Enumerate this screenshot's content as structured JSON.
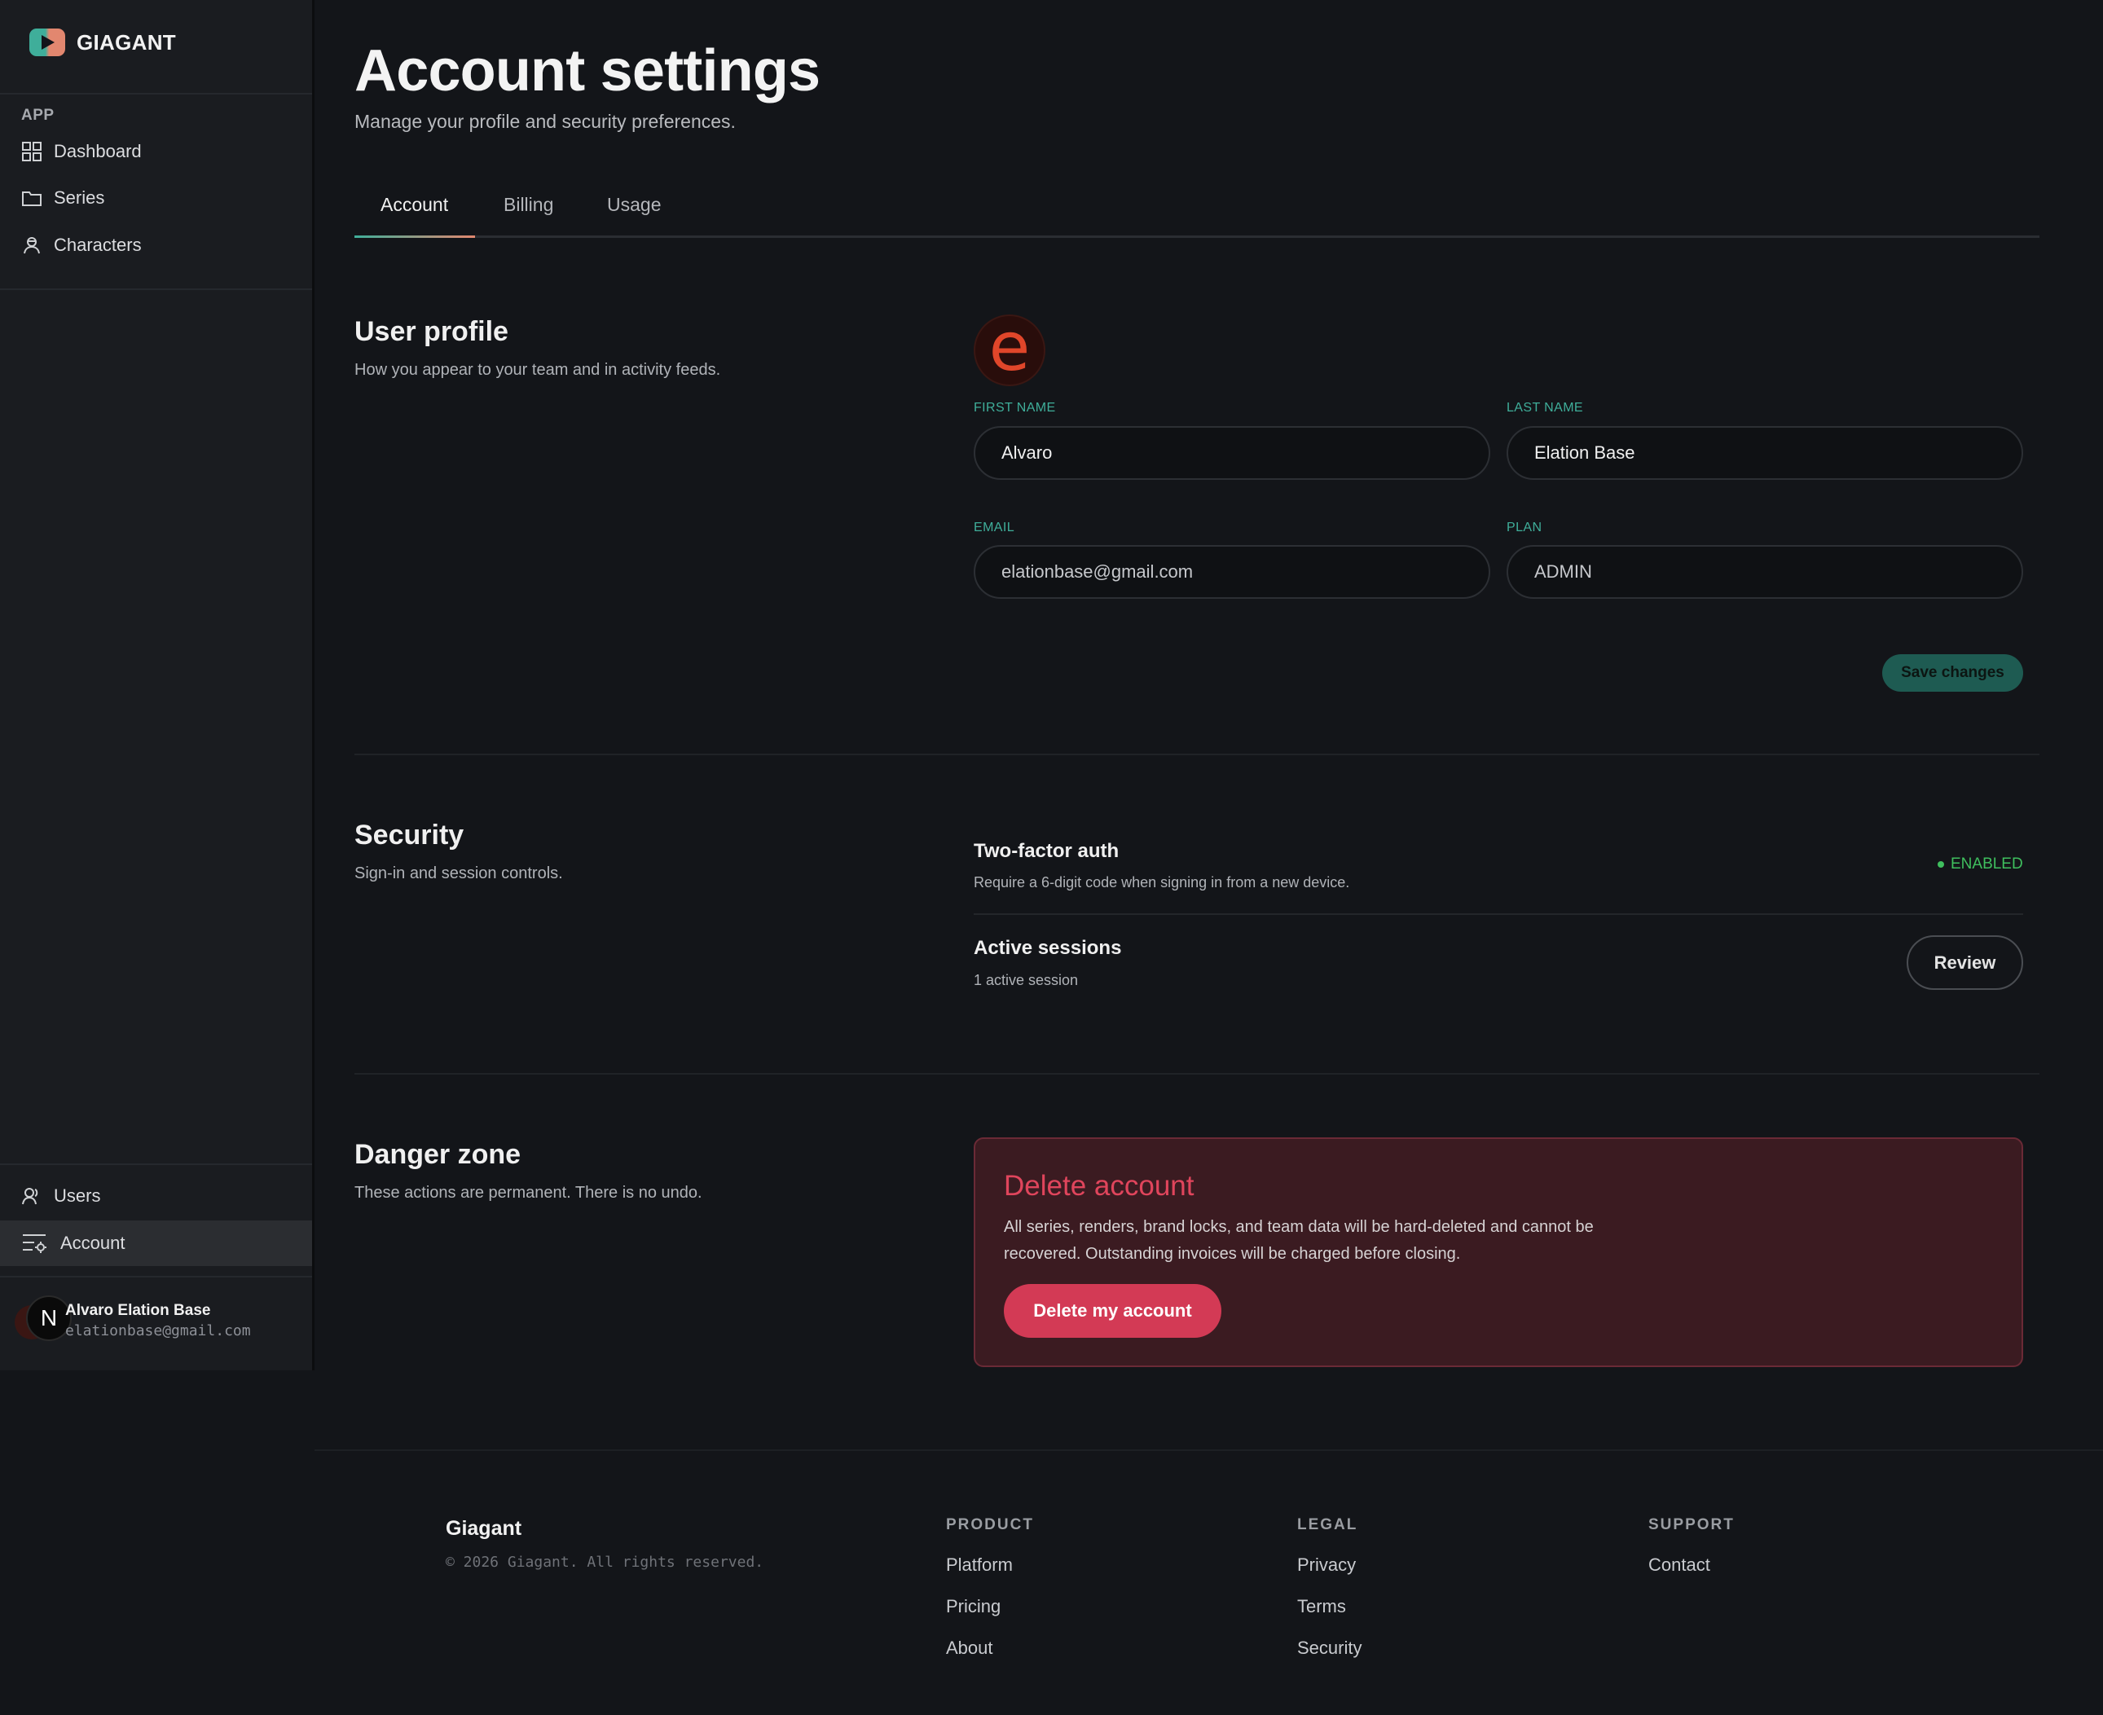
{
  "app": {
    "brand": "GIAGANT"
  },
  "sidebar": {
    "group_label": "APP",
    "items": [
      {
        "label": "Dashboard",
        "icon": "grid-icon"
      },
      {
        "label": "Series",
        "icon": "folder-icon"
      },
      {
        "label": "Characters",
        "icon": "characters-icon"
      }
    ],
    "bottom_items": [
      {
        "label": "Users",
        "icon": "users-icon"
      },
      {
        "label": "Account",
        "icon": "settings-list-icon",
        "active": true
      }
    ],
    "user": {
      "initial": "N",
      "name": "Alvaro Elation Base",
      "email": "elationbase@gmail.com"
    }
  },
  "page": {
    "title": "Account settings",
    "subtitle": "Manage your profile and security preferences.",
    "tabs": [
      {
        "label": "Account",
        "active": true
      },
      {
        "label": "Billing"
      },
      {
        "label": "Usage"
      }
    ]
  },
  "profile": {
    "title": "User profile",
    "description": "How you appear to your team and in activity feeds.",
    "avatar_letter": "e",
    "first_name_label": "FIRST NAME",
    "first_name": "Alvaro",
    "last_name_label": "LAST NAME",
    "last_name": "Elation Base",
    "email_label": "EMAIL",
    "email": "elationbase@gmail.com",
    "plan_label": "PLAN",
    "plan": "ADMIN",
    "save_label": "Save changes"
  },
  "security": {
    "title": "Security",
    "description": "Sign-in and session controls.",
    "two_factor_title": "Two-factor auth",
    "two_factor_desc": "Require a 6-digit code when signing in from a new device.",
    "two_factor_status": "ENABLED",
    "sessions_title": "Active sessions",
    "sessions_desc": "1 active session",
    "review_label": "Review"
  },
  "danger": {
    "title": "Danger zone",
    "description": "These actions are permanent. There is no undo.",
    "card_title": "Delete account",
    "card_text": "All series, renders, brand locks, and team data will be hard-deleted and cannot be recovered. Outstanding invoices will be charged before closing.",
    "button_label": "Delete my account"
  },
  "footer": {
    "brand": "Giagant",
    "copyright": "© 2026 Giagant. All rights reserved.",
    "columns": [
      {
        "heading": "PRODUCT",
        "links": [
          "Platform",
          "Pricing",
          "About"
        ]
      },
      {
        "heading": "LEGAL",
        "links": [
          "Privacy",
          "Terms",
          "Security"
        ]
      },
      {
        "heading": "SUPPORT",
        "links": [
          "Contact"
        ]
      }
    ]
  },
  "colors": {
    "accent": "#3fae9a",
    "accent_warm": "#e2876f",
    "danger": "#d33a55",
    "success": "#3fbf5e",
    "background": "#131519"
  }
}
